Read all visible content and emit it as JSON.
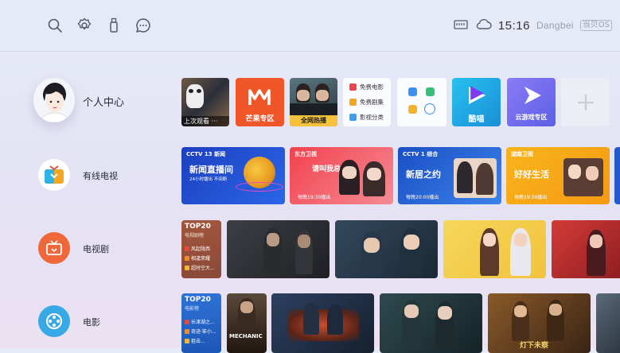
{
  "topbar": {
    "icons": [
      "search-icon",
      "gear-icon",
      "usb-icon",
      "message-icon"
    ],
    "status_icons": [
      "ethernet-icon",
      "cloud-icon"
    ],
    "clock": "15:16",
    "brand": "Dangbei",
    "brand_secondary": "当贝OS"
  },
  "nav": [
    {
      "label": "个人中心",
      "icon": "avatar"
    },
    {
      "label": "有线电视",
      "icon": "tv-app-icon"
    },
    {
      "label": "电视剧",
      "icon": "tv-icon"
    },
    {
      "label": "电影",
      "icon": "film-reel-icon"
    }
  ],
  "apps_row": {
    "history_caption": "上次观看 ···",
    "mango_label": "芒果专区",
    "hot_caption": "全网热播",
    "list_items": [
      "免费电影",
      "免费剧集",
      "影视分类"
    ],
    "kugou_label": "酷喵",
    "cloud_game_label": "云游戏专区"
  },
  "tv_row": [
    {
      "logo": "CCTV 13 新闻",
      "title": "新闻直播间",
      "time": "24小时播出 不间断"
    },
    {
      "logo": "东方卫视",
      "title": "请叫我总监",
      "time": "每晚19:30播出"
    },
    {
      "logo": "CCTV 1 综合",
      "title": "新居之约",
      "time": "每晚20:00播出"
    },
    {
      "logo": "湖南卫视",
      "title": "好好生活",
      "time": "每晚19:30播出"
    }
  ],
  "drama_row": {
    "top20_title": "TOP20",
    "top20_sub": "电视剧榜",
    "top20_items": [
      "风起陇西",
      "相逢荣耀",
      "超时空大..."
    ]
  },
  "movie_row": {
    "top20_title": "TOP20",
    "top20_sub": "电影榜",
    "top20_items": [
      "长津湖之...",
      "奇迹·笨小...",
      "狙击..."
    ],
    "poster_texts": [
      "MECHANIC",
      "灯下未察"
    ]
  },
  "colors": {
    "accent": "#e8732a",
    "mango": "#f0562a",
    "kugou": "#20b4e6",
    "cloud_game": "#7b6cf0",
    "top20": "#a0563d"
  }
}
